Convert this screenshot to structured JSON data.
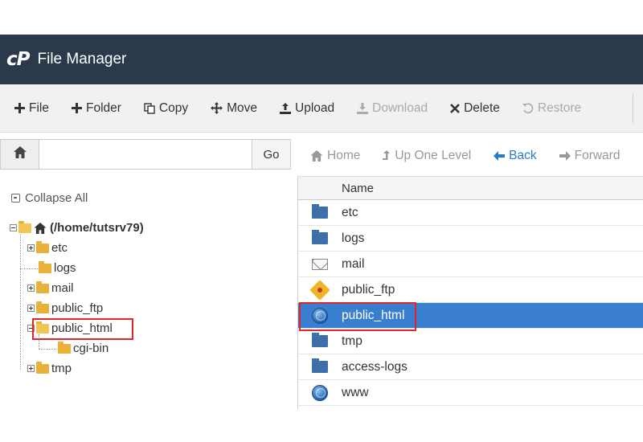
{
  "header": {
    "logo": "cP",
    "title": "File Manager"
  },
  "toolbar": {
    "file": "File",
    "folder": "Folder",
    "copy": "Copy",
    "move": "Move",
    "upload": "Upload",
    "download": "Download",
    "delete": "Delete",
    "restore": "Restore"
  },
  "pathbar": {
    "input_value": "",
    "go": "Go"
  },
  "nav": {
    "home": "Home",
    "up": "Up One Level",
    "back": "Back",
    "forward": "Forward"
  },
  "tree": {
    "collapse_all": "Collapse All",
    "root": "(/home/tutsrv79)",
    "items": [
      "etc",
      "logs",
      "mail",
      "public_ftp",
      "public_html",
      "cgi-bin",
      "tmp"
    ]
  },
  "filelist": {
    "header": "Name",
    "rows": [
      {
        "name": "etc",
        "icon": "folder-icon"
      },
      {
        "name": "logs",
        "icon": "folder-icon"
      },
      {
        "name": "mail",
        "icon": "mail-icon"
      },
      {
        "name": "public_ftp",
        "icon": "ftp-icon"
      },
      {
        "name": "public_html",
        "icon": "globe-icon",
        "selected": true
      },
      {
        "name": "tmp",
        "icon": "folder-icon"
      },
      {
        "name": "access-logs",
        "icon": "folder-icon"
      },
      {
        "name": "www",
        "icon": "globe-icon"
      }
    ]
  },
  "colors": {
    "topbar": "#2b3a4a",
    "selected": "#3a7ed0",
    "highlight": "#e0262a",
    "folder": "#e8b23a"
  }
}
